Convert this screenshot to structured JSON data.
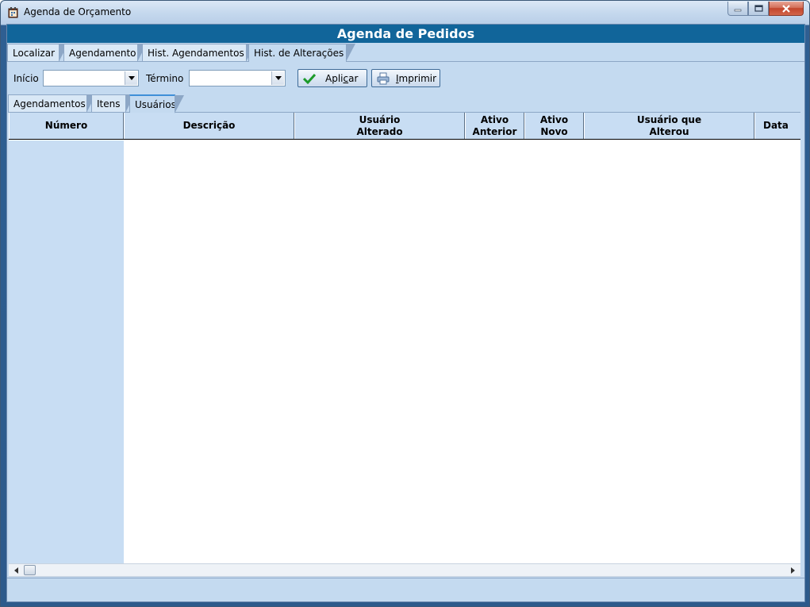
{
  "window": {
    "title": "Agenda de Orçamento"
  },
  "header": {
    "title": "Agenda de Pedidos"
  },
  "main_tabs": [
    {
      "label": "Localizar"
    },
    {
      "label": "Agendamento"
    },
    {
      "label": "Hist. Agendamentos"
    },
    {
      "label": "Hist. de Alterações",
      "active": true
    }
  ],
  "filters": {
    "inicio_label": "Início",
    "inicio_value": "",
    "termino_label": "Término",
    "termino_value": "",
    "apply_label_pre": "Apli",
    "apply_label_underline": "c",
    "apply_label_post": "ar",
    "print_label_underline": "I",
    "print_label_post": "mprimir"
  },
  "sub_tabs": [
    {
      "label": "Agendamentos"
    },
    {
      "label": "Itens"
    },
    {
      "label": "Usuários",
      "active": true
    }
  ],
  "grid": {
    "columns": [
      {
        "label": "Número"
      },
      {
        "label": "Descrição"
      },
      {
        "label": "Usuário\nAlterado"
      },
      {
        "label": "Ativo\nAnterior"
      },
      {
        "label": "Ativo\nNovo"
      },
      {
        "label": "Usuário que\nAlterou"
      },
      {
        "label": "Data"
      }
    ],
    "rows": []
  },
  "colors": {
    "header_band": "#11659a",
    "client_bg": "#c4daf0",
    "grid_header": "#c8ddf3"
  }
}
